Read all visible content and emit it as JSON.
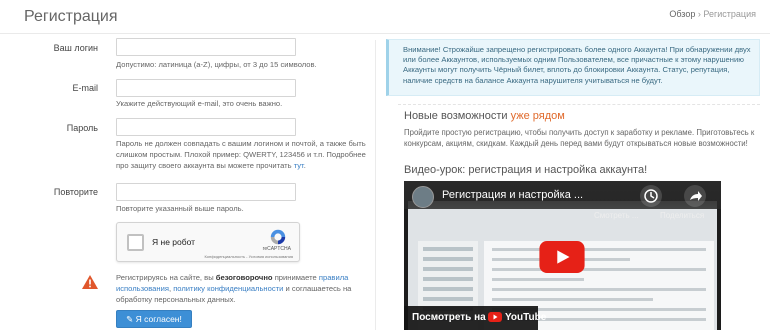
{
  "page": {
    "title": "Регистрация",
    "breadcrumb": {
      "home": "Обзор",
      "separator": "›",
      "current": "Регистрация"
    }
  },
  "form": {
    "login": {
      "label": "Ваш логин",
      "value": "",
      "help": "Допустимо: латиница (a-Z), цифры, от 3 до 15 символов."
    },
    "email": {
      "label": "E-mail",
      "value": "",
      "help": "Укажите действующий e-mail, это очень важно."
    },
    "password": {
      "label": "Пароль",
      "value": "",
      "help": "Пароль не должен совпадать с вашим логином и почтой, а также быть слишком простым. Плохой пример: QWERTY, 123456 и т.п. Подробнее про защиту своего аккаунта вы можете прочитать",
      "help_link": "тут",
      "help_end": "."
    },
    "repeat": {
      "label": "Повторите",
      "value": "",
      "help": "Повторите указанный выше пароль."
    },
    "captcha": {
      "label": "Я не робот",
      "brand": "reCAPTCHA",
      "links": "Конфиденциальность - Условия использования"
    },
    "agreement": {
      "text_1": "Регистрируясь на сайте, вы",
      "bold": "безоговорочно",
      "text_2": "принимаете",
      "link_1": "правила использования",
      "comma": ",",
      "link_2": "политику конфиденциальности",
      "text_3": "и соглашаетесь на обработку персональных данных."
    },
    "submit": {
      "icon": "✎",
      "label": "Я согласен!"
    }
  },
  "right": {
    "alert": "Внимание! Строжайше запрещено регистрировать более одного Аккаунта! При обнаружении двух или более Аккаунтов, используемых одним Пользователем, все причастные к этому нарушению Аккаунты могут получить Чёрный билет, вплоть до блокировки Аккаунта. Статус, репутация, наличие средств на балансе Аккаунта нарушителя учитываться не будут.",
    "features": {
      "title": "Новые возможности",
      "highlight": "уже рядом",
      "text": "Пройдите простую регистрацию, чтобы получить доступ к заработку и рекламе. Приготовьтесь к конкурсам, акциям, скидкам. Каждый день перед вами будут открываться новые возможности!"
    },
    "video": {
      "section_title": "Видео-урок: регистрация и настройка аккаунта!",
      "title": "Регистрация и настройка ...",
      "watch_later": "Смотреть ...",
      "share": "Поделиться",
      "watch_on": "Посмотреть на",
      "platform": "YouTube"
    }
  },
  "colors": {
    "accent": "#3d8fd6",
    "link": "#3a7fc4",
    "highlight": "#e06a2c",
    "alert_bg": "#eaf6fb",
    "youtube_red": "#e62117"
  }
}
